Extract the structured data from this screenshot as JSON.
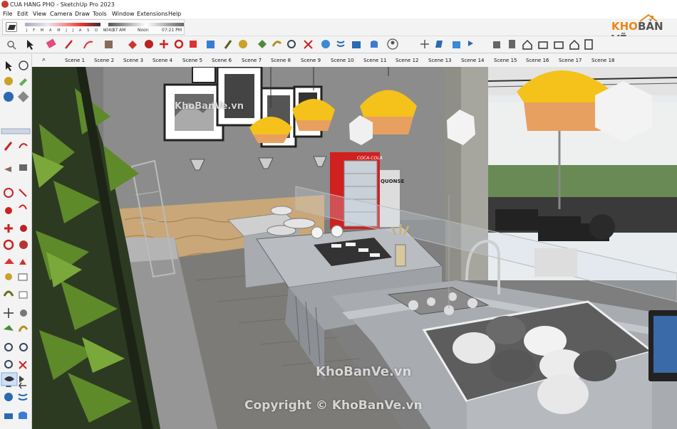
{
  "window": {
    "title": "CUA HANG PHO - SketchUp Pro 2023"
  },
  "menu": [
    "File",
    "Edit",
    "View",
    "Camera",
    "Draw",
    "Tools",
    "Window",
    "Extensions",
    "Help"
  ],
  "shadow": {
    "months": "J F M A M J J A S O N D",
    "time_start": "04:37 AM",
    "time_mid": "Noon",
    "time_end": "07:21 PM"
  },
  "scenes": [
    "Scene 1",
    "Scene 2",
    "Scene 3",
    "Scene 4",
    "Scene 5",
    "Scene 6",
    "Scene 7",
    "Scene 8",
    "Scene 9",
    "Scene 10",
    "Scene 11",
    "Scene 12",
    "Scene 13",
    "Scene 14",
    "Scene 15",
    "Scene 16",
    "Scene 17",
    "Scene 18"
  ],
  "logo": {
    "part1": "KHO",
    "part2": "BẢN VẼ"
  },
  "watermarks": {
    "top": "KhoBanVe.vn",
    "center": "KhoBanVe.vn",
    "bottom": "Copyright © KhoBanVe.vn"
  },
  "model": {
    "fridge_brand": "COCA-COLA",
    "poster_text": "QUONSE"
  },
  "colors": {
    "lamp": "#f4c21a",
    "lamp_copper": "#e8a060",
    "wall": "#8a8a8a",
    "counter": "#b9bcc1"
  }
}
